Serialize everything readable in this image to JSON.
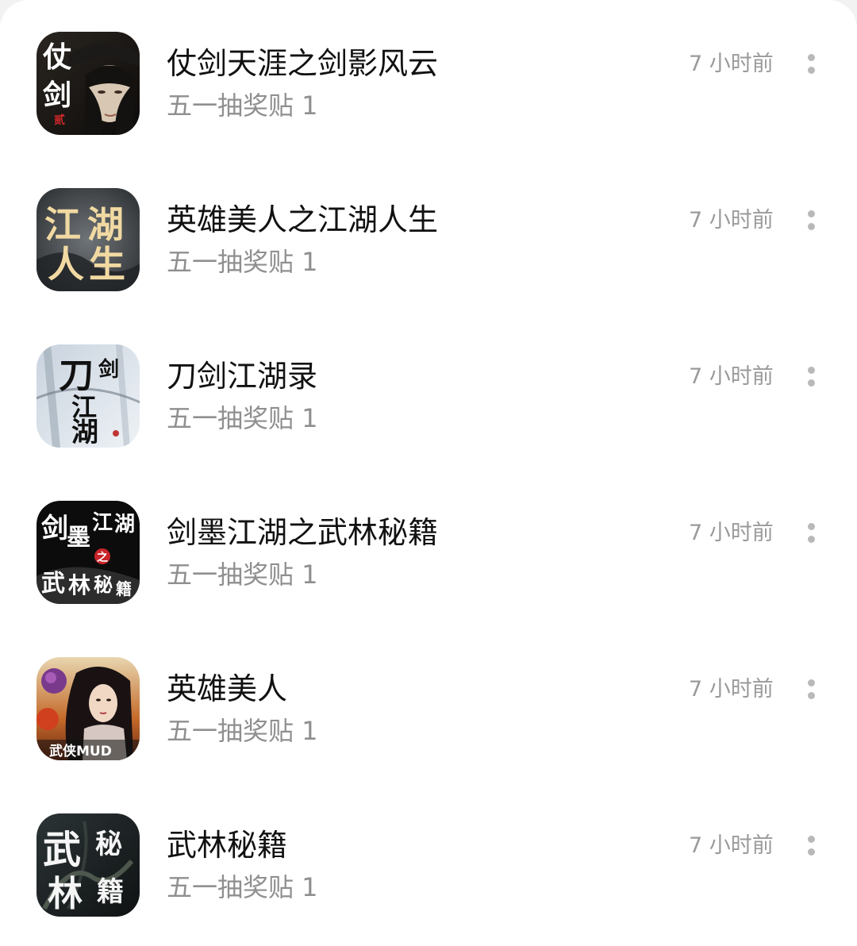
{
  "items": [
    {
      "title": "仗剑天涯之剑影风云",
      "subtitle": "五一抽奖贴 1",
      "time": "7 小时前",
      "icon_text": [
        "仗",
        "剑",
        "贰"
      ]
    },
    {
      "title": "英雄美人之江湖人生",
      "subtitle": "五一抽奖贴 1",
      "time": "7 小时前",
      "icon_text": [
        "江",
        "湖",
        "人",
        "生"
      ]
    },
    {
      "title": "刀剑江湖录",
      "subtitle": "五一抽奖贴 1",
      "time": "7 小时前",
      "icon_text": [
        "刀",
        "剑",
        "江",
        "湖"
      ]
    },
    {
      "title": "剑墨江湖之武林秘籍",
      "subtitle": "五一抽奖贴 1",
      "time": "7 小时前",
      "icon_text": [
        "剑",
        "墨",
        "江",
        "湖",
        "之",
        "武",
        "林",
        "秘",
        "籍"
      ]
    },
    {
      "title": "英雄美人",
      "subtitle": "五一抽奖贴 1",
      "time": "7 小时前",
      "icon_text": [
        "武侠MUD"
      ]
    },
    {
      "title": "武林秘籍",
      "subtitle": "五一抽奖贴 1",
      "time": "7 小时前",
      "icon_text": [
        "武",
        "秘",
        "林",
        "籍"
      ]
    }
  ],
  "colors": {
    "title": "#111111",
    "subtitle": "#8f8f8f",
    "time": "#9a9a9a",
    "more_dots": "#b9b9b9",
    "background": "#ffffff"
  }
}
